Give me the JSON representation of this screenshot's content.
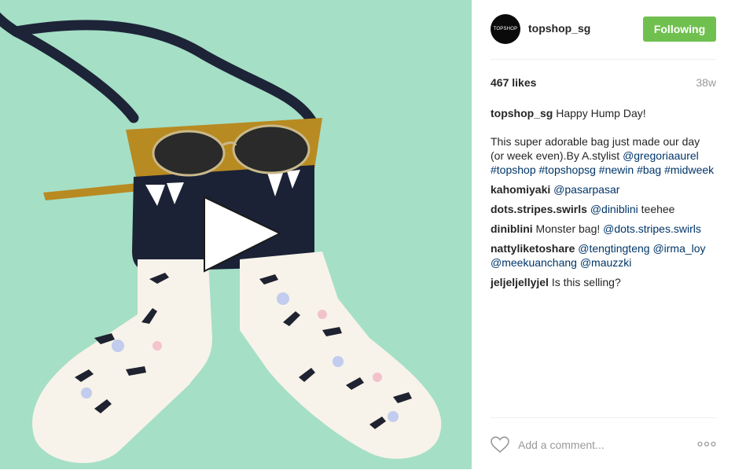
{
  "post": {
    "media": {
      "play_icon": "play-icon",
      "background_color": "#a5dfc6"
    },
    "header": {
      "avatar_text": "TOPSHOP",
      "username": "topshop_sg",
      "follow_label": "Following",
      "follow_color": "#70c050"
    },
    "meta": {
      "likes": "467 likes",
      "time": "38w"
    },
    "caption": {
      "username": "topshop_sg",
      "line1": "Happy Hump Day!",
      "line2": "This super adorable bag just made our day (or week even).By A.stylist",
      "mention": "@gregoriaaurel",
      "tags": [
        "#topshop",
        "#topshopsg",
        "#newin",
        "#bag",
        "#midweek"
      ]
    },
    "comments": [
      {
        "user": "kahomiyaki",
        "mentions": [
          "@pasarpasar"
        ],
        "text": ""
      },
      {
        "user": "dots.stripes.swirls",
        "mentions": [
          "@diniblini"
        ],
        "text": "teehee"
      },
      {
        "user": "diniblini",
        "pre": "Monster bag!",
        "mentions": [
          "@dots.stripes.swirls"
        ],
        "text": ""
      },
      {
        "user": "nattyliketoshare",
        "mentions": [
          "@tengtingteng",
          "@irma_loy",
          "@meekuanchang",
          "@mauzzki"
        ],
        "text": ""
      },
      {
        "user": "jeljeljellyjel",
        "mentions": [],
        "text": "Is this selling?"
      }
    ],
    "footer": {
      "heart_icon": "heart-icon",
      "add_comment_placeholder": "Add a comment...",
      "more_icon": "more-options-icon"
    }
  }
}
